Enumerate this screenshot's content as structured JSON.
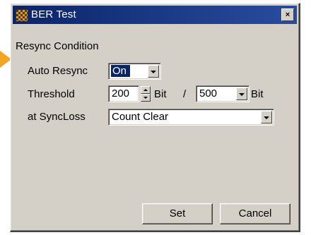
{
  "window": {
    "title": "BER Test",
    "icon": "ber-test-app-icon",
    "close_glyph": "×"
  },
  "section": {
    "title": "Resync Condition"
  },
  "auto_resync": {
    "label": "Auto Resync",
    "value": "On"
  },
  "threshold": {
    "label": "Threshold",
    "value": "200",
    "unit": "Bit",
    "separator": "/",
    "total_value": "500",
    "total_unit": "Bit"
  },
  "sync_loss": {
    "label": "at SyncLoss",
    "value": "Count Clear"
  },
  "buttons": {
    "set": "Set",
    "cancel": "Cancel"
  },
  "colors": {
    "titlebar": "#0a246a",
    "face": "#d4d0c8",
    "pointer": "#f4a623"
  }
}
